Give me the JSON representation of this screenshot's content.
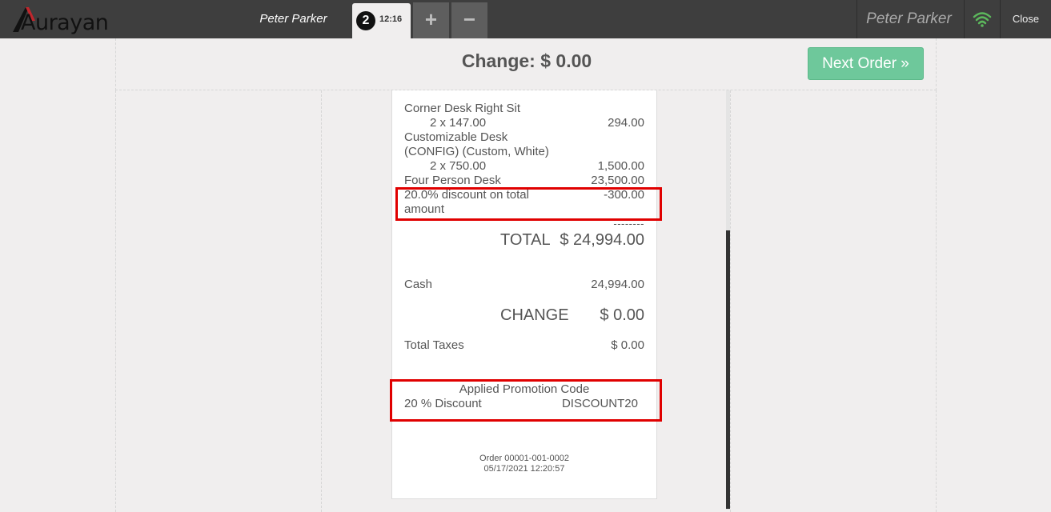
{
  "brand": {
    "logo_text": "Aurayan"
  },
  "topbar": {
    "cashier": "Peter Parker",
    "order_tab": {
      "number": "2",
      "time": "12:16"
    },
    "add_symbol": "+",
    "remove_symbol": "−",
    "user": "Peter Parker",
    "close_label": "Close",
    "wifi_color": "#5cb85c"
  },
  "header": {
    "change_title": "Change: $ 0.00",
    "next_order_label": "Next Order »"
  },
  "receipt": {
    "lines": [
      {
        "name": "Corner Desk Right Sit",
        "detail": "2 x 147.00",
        "amount": "294.00"
      },
      {
        "name": "Customizable Desk",
        "name2": "(CONFIG) (Custom, White)",
        "detail": "2 x 750.00",
        "amount": "1,500.00"
      },
      {
        "name": "Four Person Desk",
        "amount": "23,500.00"
      },
      {
        "name": "20.0% discount on total",
        "name2": "amount",
        "amount": "-300.00"
      }
    ],
    "dashes": "--------",
    "total_label": "TOTAL",
    "total_value": "$ 24,994.00",
    "payment_method": "Cash",
    "payment_amount": "24,994.00",
    "change_label": "CHANGE",
    "change_value": "$ 0.00",
    "taxes_label": "Total Taxes",
    "taxes_value": "$ 0.00",
    "promo": {
      "title": "Applied Promotion Code",
      "name": "20 % Discount",
      "code": "DISCOUNT20"
    },
    "order_ref": "Order 00001-001-0002",
    "timestamp": "05/17/2021 12:20:57"
  },
  "colors": {
    "topbar": "#3e3e3e",
    "next_order": "#6ec89b",
    "highlight": "#e00000"
  }
}
